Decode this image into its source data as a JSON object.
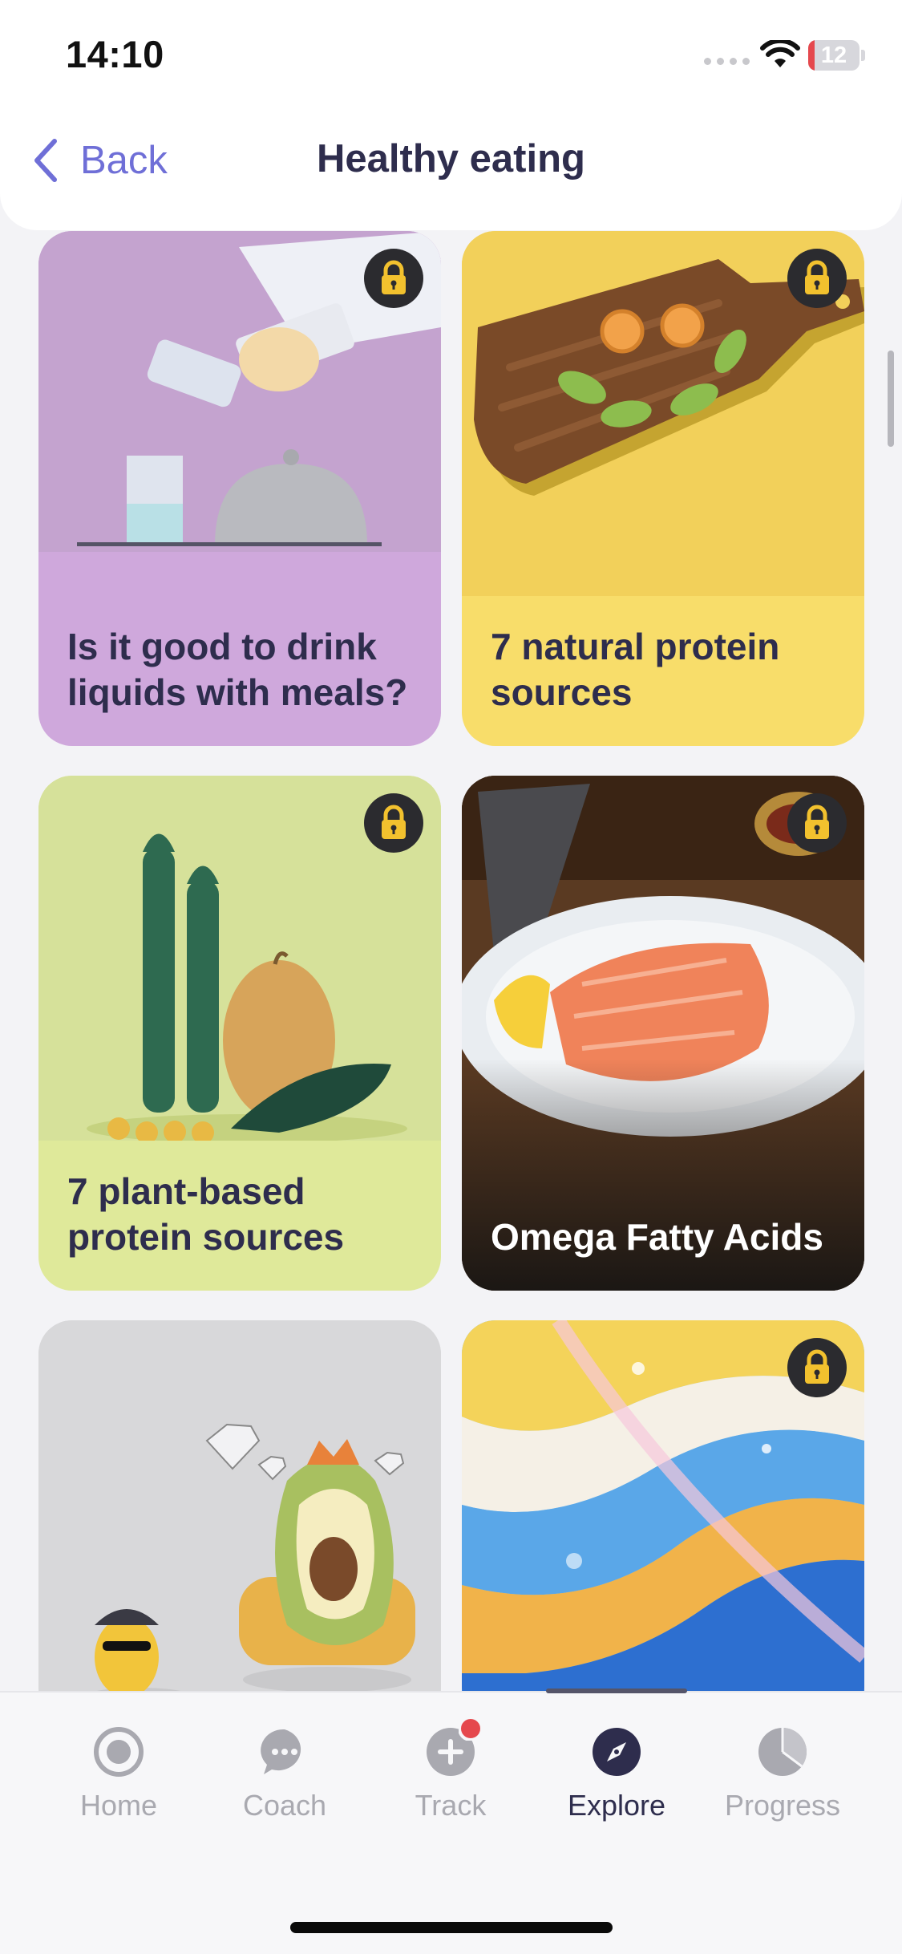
{
  "status_bar": {
    "time": "14:10",
    "battery_level": "12",
    "battery_fraction": 0.12
  },
  "header": {
    "back_label": "Back",
    "title": "Healthy eating"
  },
  "cards": [
    {
      "title": "Is it good to drink liquids with meals?",
      "locked": true,
      "background": "#cfa8dc",
      "art": "water-pouring-illustration"
    },
    {
      "title": "7 natural protein sources",
      "locked": true,
      "background": "#f8dd6a",
      "art": "cutting-board-illustration"
    },
    {
      "title": "7 plant-based protein sources",
      "locked": true,
      "background": "#dfe99a",
      "art": "asparagus-potato-illustration"
    },
    {
      "title": "Omega Fatty Acids",
      "locked": true,
      "background": "#1b1714",
      "art": "salmon-photo"
    },
    {
      "title": "",
      "locked": false,
      "background": "#d9d9db",
      "art": "avocado-king-illustration"
    },
    {
      "title": "",
      "locked": true,
      "background": "#7cc1f0",
      "art": "oil-swirl-photo"
    }
  ],
  "tabbar": {
    "tabs": [
      {
        "label": "Home",
        "icon": "home-circle-icon",
        "active": false
      },
      {
        "label": "Coach",
        "icon": "chat-bubble-icon",
        "active": false
      },
      {
        "label": "Track",
        "icon": "plus-circle-icon",
        "active": false,
        "badge": true
      },
      {
        "label": "Explore",
        "icon": "compass-icon",
        "active": true
      },
      {
        "label": "Progress",
        "icon": "pie-chart-icon",
        "active": false
      }
    ]
  },
  "colors": {
    "accent": "#6f6fd7",
    "text_dark": "#2e2d4d",
    "tab_inactive": "#a9a9b0",
    "badge": "#e5484d",
    "lock_gold": "#f2c12e"
  }
}
